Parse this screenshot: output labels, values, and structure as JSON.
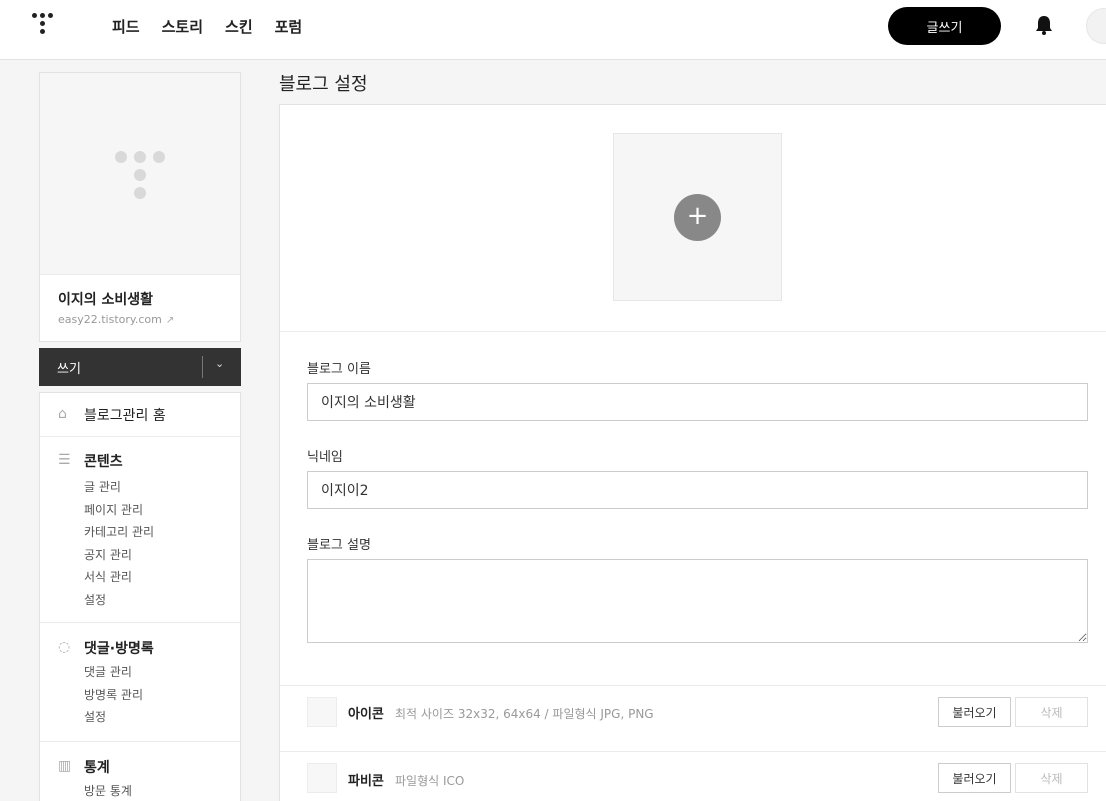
{
  "header": {
    "nav": [
      "피드",
      "스토리",
      "스킨",
      "포럼"
    ],
    "write_button": "글쓰기"
  },
  "sidebar": {
    "blog_title": "이지의 소비생활",
    "blog_url": "easy22.tistory.com",
    "write_label": "쓰기",
    "home_label": "블로그관리 홈",
    "contents": {
      "title": "콘텐츠",
      "items": [
        "글 관리",
        "페이지 관리",
        "카테고리 관리",
        "공지 관리",
        "서식 관리",
        "설정"
      ]
    },
    "comments": {
      "title": "댓글·방명록",
      "items": [
        "댓글 관리",
        "방명록 관리",
        "설정"
      ]
    },
    "stats": {
      "title": "통계",
      "items": [
        "방문 통계"
      ]
    }
  },
  "main": {
    "page_title": "블로그 설정",
    "blog_name_label": "블로그 이름",
    "blog_name_value": "이지의 소비생활",
    "nickname_label": "닉네임",
    "nickname_value": "이지이2",
    "description_label": "블로그 설명",
    "description_value": "",
    "icon_row": {
      "name": "아이콘",
      "desc": "최적 사이즈 32x32, 64x64 / 파일형식 JPG, PNG",
      "load": "불러오기",
      "delete": "삭제"
    },
    "favicon_row": {
      "name": "파비콘",
      "desc": "파일형식 ICO",
      "load": "불러오기",
      "delete": "삭제"
    }
  },
  "colors": {
    "write_button_bg": "#000000",
    "write_bar_bg": "#333333",
    "page_bg": "#f5f5f5"
  }
}
